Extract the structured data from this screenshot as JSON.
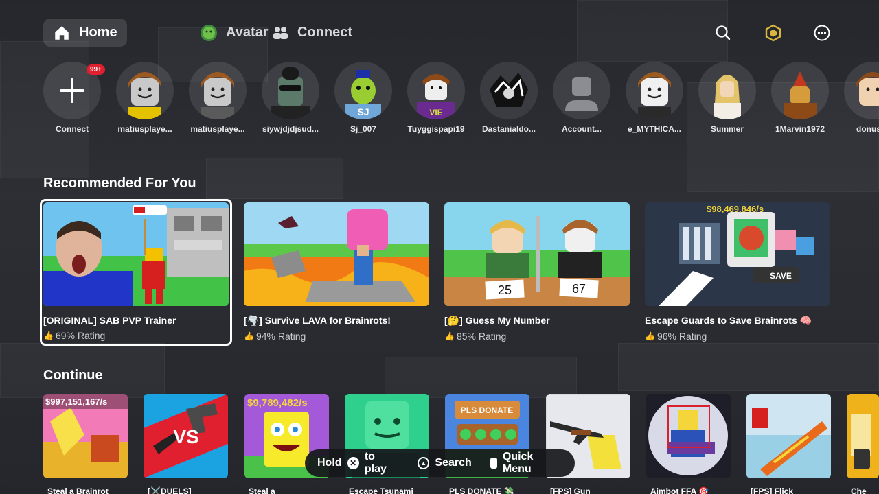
{
  "nav": {
    "home": "Home",
    "avatar": "Avatar",
    "connect": "Connect",
    "icons": [
      "search-icon",
      "robux-icon",
      "more-icon"
    ]
  },
  "friends": [
    {
      "name": "Connect",
      "badge": "99+"
    },
    {
      "name": "matiusplaye..."
    },
    {
      "name": "matiusplaye..."
    },
    {
      "name": "siywjdjdjsud..."
    },
    {
      "name": "Sj_007"
    },
    {
      "name": "Tuyggispapi19"
    },
    {
      "name": "Dastanialdo..."
    },
    {
      "name": "Account..."
    },
    {
      "name": "e_MYTHICA..."
    },
    {
      "name": "Summer"
    },
    {
      "name": "1Marvin1972"
    },
    {
      "name": "donusfir"
    }
  ],
  "recommended": {
    "title": "Recommended For You",
    "items": [
      {
        "title": "[ORIGINAL] SAB PVP Trainer",
        "rating": "69% Rating"
      },
      {
        "title": "[🌪️] Survive LAVA for Brainrots!",
        "rating": "94% Rating"
      },
      {
        "title": "[🤔] Guess My Number",
        "rating": "85% Rating",
        "thumb_numbers": [
          "25",
          "67"
        ]
      },
      {
        "title": "Escape Guards to Save Brainrots 🧠",
        "rating": "96% Rating",
        "thumb_money": "$98,469,846/s",
        "thumb_save": "SAVE"
      }
    ]
  },
  "continue": {
    "title": "Continue",
    "items": [
      {
        "label": "Steal a Brainrot",
        "thumb_text": "$997,151,167/s"
      },
      {
        "label": "[⚔️DUELS]",
        "thumb_text": "VS"
      },
      {
        "label": "Steal a",
        "thumb_text": "$9,789,482/s"
      },
      {
        "label": "Escape Tsunami"
      },
      {
        "label": "PLS DONATE 💸",
        "thumb_text": "PLS DONATE"
      },
      {
        "label": "[FPS] Gun"
      },
      {
        "label": "Aimbot FFA 🎯"
      },
      {
        "label": "[FPS] Flick"
      },
      {
        "label": "Che"
      }
    ]
  },
  "hints": {
    "hold": "Hold",
    "to_play": "to play",
    "search": "Search",
    "quick_menu": "Quick Menu"
  },
  "colors": {
    "background": "#2e3036",
    "badge": "#e0202f",
    "selection": "#ffffff"
  }
}
